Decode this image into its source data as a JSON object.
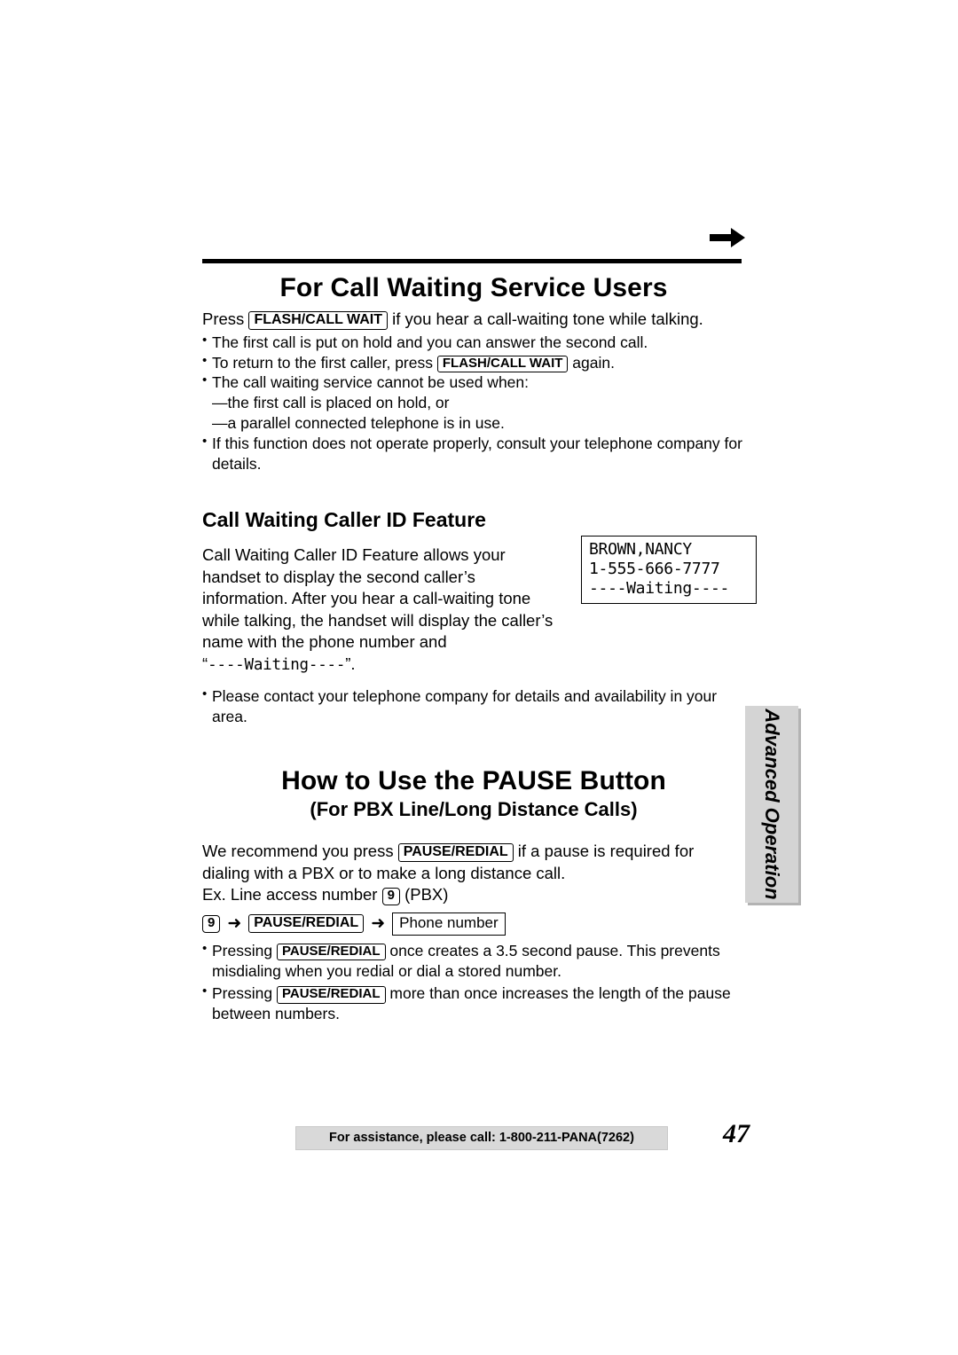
{
  "page": {
    "number": "47",
    "side_tab": "Advanced Operation",
    "footer": "For assistance, please call: 1-800-211-PANA(7262)"
  },
  "section1": {
    "title": "For Call Waiting Service Users",
    "intro_pre": "Press",
    "intro_key": "FLASH/CALL WAIT",
    "intro_post": "if you hear a call-waiting tone while talking.",
    "bullets": [
      {
        "pre": "The first call is put on hold and you can answer the second call.",
        "key": "",
        "post": ""
      },
      {
        "pre": "To return to the first caller, press",
        "key": "FLASH/CALL WAIT",
        "post": "again."
      },
      {
        "pre": "The call waiting service cannot be used when:",
        "key": "",
        "post": ""
      }
    ],
    "dashes": [
      "—the first call is placed on hold, or",
      "—a parallel connected telephone is in use."
    ],
    "last_bullet": "If this function does not operate properly, consult your telephone company for",
    "last_bullet_cont": "details."
  },
  "section2": {
    "title": "Call Waiting Caller ID Feature",
    "paragraph_lines": [
      "Call Waiting Caller ID Feature allows your",
      "handset to display the second caller’s",
      "information. After you hear a call-waiting tone",
      "while talking, the handset will display the caller’s",
      "name with the phone number and"
    ],
    "paragraph_quote_open": "“",
    "paragraph_quote_mono": "----Waiting----",
    "paragraph_quote_close": "”.",
    "lcd": {
      "line1": "BROWN,NANCY",
      "line2": "1-555-666-7777",
      "line3": "----Waiting----"
    },
    "note_bullet": "Please contact your telephone company for details and availability in your area."
  },
  "section3": {
    "title": "How to Use the PAUSE Button",
    "subtitle": "(For PBX Line/Long Distance Calls)",
    "para_pre": "We recommend you press",
    "para_key": "PAUSE/REDIAL",
    "para_post": "if a pause is required for",
    "para_line2": "dialing with a PBX or to make a long distance call.",
    "ex_pre": "Ex.  Line access number",
    "ex_key": "9",
    "ex_post": "(PBX)",
    "sequence": {
      "key_num": "9",
      "arrow": "➜",
      "key_pause": "PAUSE/REDIAL",
      "arrow2": "➜",
      "box_label": "Phone number"
    },
    "bullets": [
      {
        "pre": "Pressing",
        "key": "PAUSE/REDIAL",
        "post": "once creates a 3.5 second pause. This prevents",
        "cont": "misdialing when you redial or dial a stored number."
      },
      {
        "pre": "Pressing",
        "key": "PAUSE/REDIAL",
        "post": "more than once increases the length of the pause",
        "cont": "between numbers."
      }
    ]
  }
}
